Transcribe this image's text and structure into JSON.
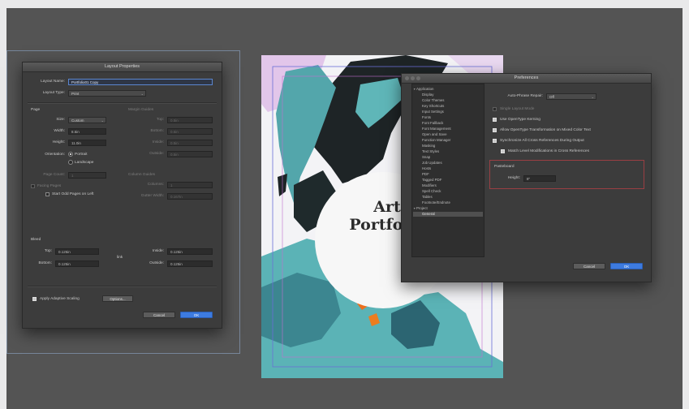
{
  "layout_properties": {
    "title": "Layout Properties",
    "layout_name_label": "Layout Name:",
    "layout_name_value": "Portfolio01 Copy",
    "layout_type_label": "Layout Type:",
    "layout_type_value": "Print",
    "page": {
      "heading": "Page",
      "size_label": "Size:",
      "size_value": "Custom",
      "width_label": "Width:",
      "width_value": "8.5in",
      "height_label": "Height:",
      "height_value": "11.0in",
      "orientation_label": "Orientation:",
      "portrait_label": "Portrait",
      "landscape_label": "Landscape",
      "page_count_label": "Page Count:",
      "page_count_value": "1",
      "facing_pages_label": "Facing Pages",
      "start_pages_left_label": "Start Odd Pages on Left"
    },
    "margin_guides": {
      "heading": "Margin Guides",
      "top_label": "Top:",
      "top_value": "0.5in",
      "bottom_label": "Bottom:",
      "bottom_value": "0.5in",
      "inside_label": "Inside:",
      "inside_value": "0.5in",
      "outside_label": "Outside:",
      "outside_value": "0.5in"
    },
    "column_guides": {
      "heading": "Column Guides",
      "columns_label": "Columns:",
      "columns_value": "1",
      "gutter_label": "Gutter Width:",
      "gutter_value": "0.167in"
    },
    "bleed": {
      "heading": "Bleed",
      "top_label": "Top:",
      "top_value": "0.125in",
      "bottom_label": "Bottom:",
      "bottom_value": "0.125in",
      "inside_label": "Inside:",
      "inside_value": "0.125in",
      "outside_label": "Outside:",
      "outside_value": "0.125in",
      "link_label": "link"
    },
    "adaptive_scaling_label": "Apply Adaptive Scaling",
    "options_label": "Options...",
    "cancel_label": "Cancel",
    "ok_label": "OK"
  },
  "artwork": {
    "title_line1": "Art",
    "title_line2": "Portfolio"
  },
  "preferences": {
    "title": "Preferences",
    "tree": {
      "application_label": "Application",
      "application_items": [
        "Display",
        "Color Themes",
        "Key Shortcuts",
        "Input Settings",
        "Fonts",
        "Font Fallback",
        "Font Management",
        "Open and Save",
        "Function Manager",
        "Masking",
        "Text Styles",
        "Snap",
        "Job Updates",
        "Hosts",
        "PDF",
        "Tagged PDF",
        "Modifiers",
        "Spell Check",
        "Tables",
        "Footnote/Endnote"
      ],
      "project_label": "Project",
      "project_items": [
        "General"
      ]
    },
    "auto_phrase_label": "Auto-Phrase Repair:",
    "auto_phrase_value": "Off",
    "single_layout_label": "Single Layout Mode",
    "use_opentype_label": "Use OpenType Kerning",
    "allow_transform_label": "Allow OpenType Transformation on Mixed Color Text",
    "sync_xrefs_label": "Synchronize All Cross References During Output",
    "match_level_label": "Match Level Modifications in Cross References",
    "pasteboard_heading": "Pasteboard",
    "pasteboard_height_label": "Height:",
    "pasteboard_height_value": "8\"",
    "cancel_label": "Cancel",
    "ok_label": "OK"
  }
}
